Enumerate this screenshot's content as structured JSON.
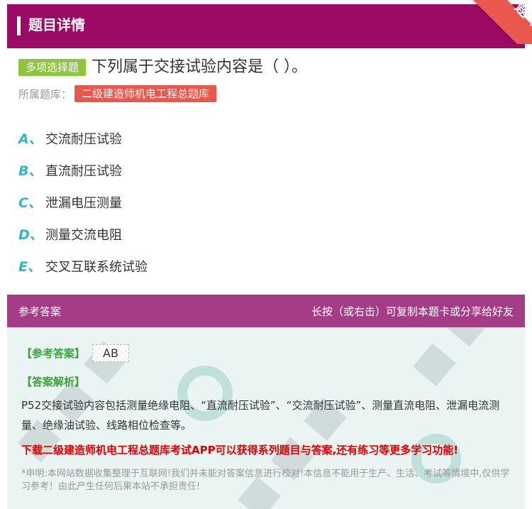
{
  "header": {
    "title": "题目详情",
    "ribbon": "题卡"
  },
  "question": {
    "type_badge": "多项选择题",
    "text": "下列属于交接试验内容是（   ）。",
    "bank_label": "所属题库：",
    "bank_name": "二级建造师机电工程总题库"
  },
  "options": [
    {
      "letter": "A、",
      "text": "交流耐压试验"
    },
    {
      "letter": "B、",
      "text": "直流耐压试验"
    },
    {
      "letter": "C、",
      "text": "泄漏电压测量"
    },
    {
      "letter": "D、",
      "text": "测量交流电阻"
    },
    {
      "letter": "E、",
      "text": "交叉互联系统试验"
    }
  ],
  "answer_section": {
    "title": "参考答案",
    "hint": "长按（或右击）可复制本题卡或分享给好友",
    "ref_label": "【参考答案】",
    "ref_value": "AB",
    "analysis_label": "【答案解析】",
    "analysis_text": "P52交接试验内容包括测量绝缘电阻、“直流耐压试验”、“交流耐压试验”、测量直流电阻、泄漏电流测量、绝缘油试验、线路相位检查等。",
    "download_text": "下载二级建造师机电工程总题库考试APP可以获得系列题目与答案,还有练习等更多学习功能!",
    "disclaimer": "*申明:本网站数据收集整理于互联网!我们并未能对答案信息进行校对!本信息不能用于生产、生活、考试等情境中,仅供学习参考！由此产生任何后果本站不承担责任!"
  },
  "colors": {
    "header_bg": "#9b0a64",
    "answer_header_bg": "#a43d86",
    "badge_green": "#8cc63f",
    "tag_red": "#e8584d",
    "option_letter": "#2fb9c4",
    "download_red": "#e00000"
  }
}
